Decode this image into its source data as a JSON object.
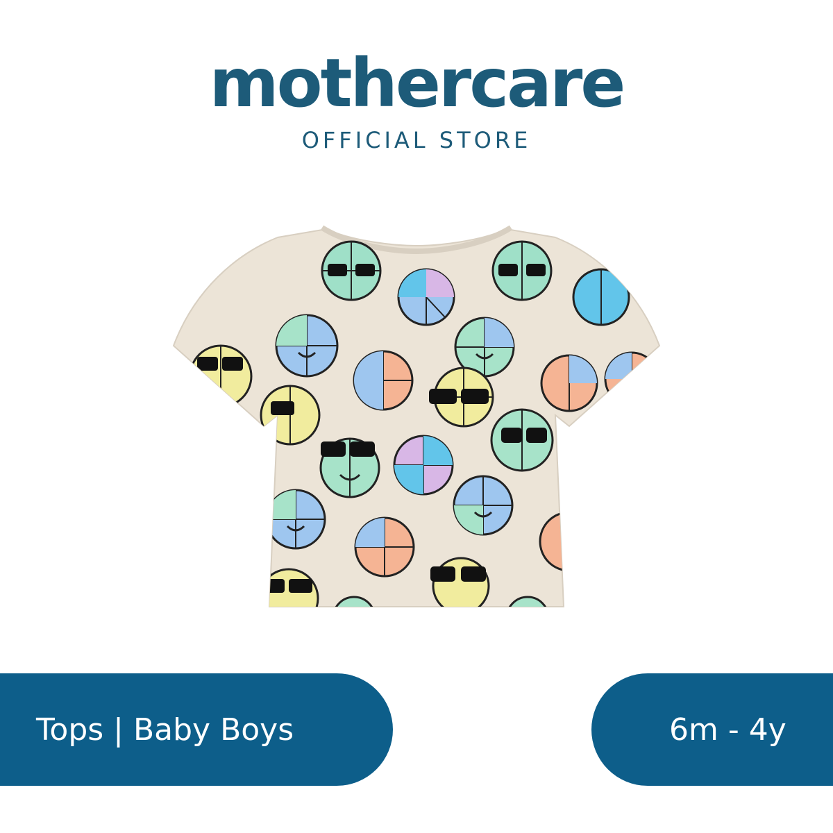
{
  "brand": {
    "name": "mothercare",
    "subtitle": "OFFICIAL STORE"
  },
  "product": {
    "image_icon": "tshirt-beach-ball-print-icon"
  },
  "tags": {
    "category": "Tops | Baby Boys",
    "age_range": "6m - 4y"
  },
  "colors": {
    "brand": "#1d5b79",
    "pill": "#0d5e8a",
    "shirt": "#ece4d7"
  }
}
